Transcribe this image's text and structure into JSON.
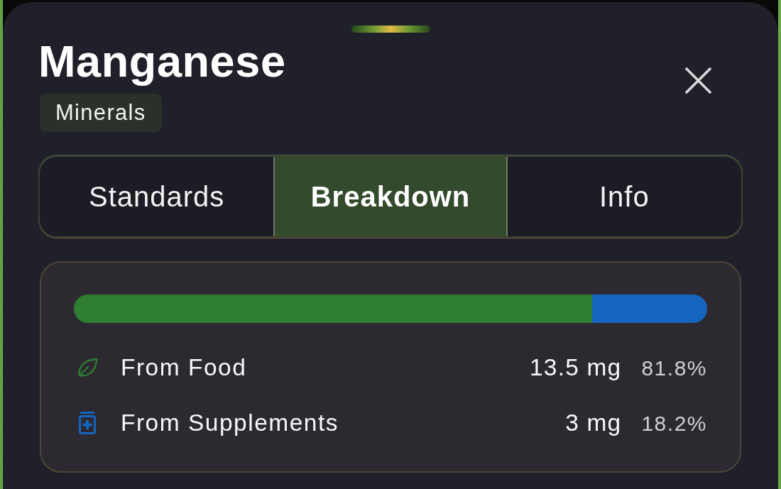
{
  "sheet": {
    "title": "Manganese",
    "category": "Minerals"
  },
  "tabs": [
    {
      "label": "Standards",
      "selected": false
    },
    {
      "label": "Breakdown",
      "selected": true
    },
    {
      "label": "Info",
      "selected": false
    }
  ],
  "breakdown": {
    "sources": [
      {
        "kind": "food",
        "label": "From Food",
        "amount": "13.5 mg",
        "percent": "81.8%",
        "level": 0.818,
        "color": "#2e7d32"
      },
      {
        "kind": "supplement",
        "label": "From Supplements",
        "amount": "3 mg",
        "percent": "18.2%",
        "level": 0.182,
        "color": "#1565c0"
      }
    ]
  }
}
